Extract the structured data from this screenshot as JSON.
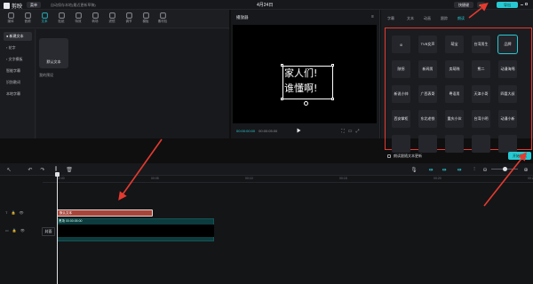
{
  "app": {
    "name": "剪映",
    "menu_label": "菜单",
    "draft_note": "自动保存本地(最近更新草稿)",
    "title": "4月24日"
  },
  "top_right": {
    "shortcut": "快捷键",
    "pro": "",
    "export": "导出"
  },
  "toolbar": {
    "items": [
      {
        "label": "媒体",
        "icon": "media-icon"
      },
      {
        "label": "音频",
        "icon": "audio-icon"
      },
      {
        "label": "文本",
        "icon": "text-icon",
        "active": true
      },
      {
        "label": "贴纸",
        "icon": "sticker-icon"
      },
      {
        "label": "特效",
        "icon": "effects-icon"
      },
      {
        "label": "转场",
        "icon": "transition-icon"
      },
      {
        "label": "滤镜",
        "icon": "filter-icon"
      },
      {
        "label": "调节",
        "icon": "adjust-icon"
      },
      {
        "label": "模板",
        "icon": "template-icon"
      },
      {
        "label": "素材包",
        "icon": "pack-icon"
      }
    ]
  },
  "sidebar": {
    "items": [
      {
        "label": "● 新建文本",
        "active": true
      },
      {
        "label": "› 花字"
      },
      {
        "label": "› 文字模板"
      },
      {
        "label": "智能字幕"
      },
      {
        "label": "识别歌词"
      },
      {
        "label": "本地字幕"
      }
    ]
  },
  "text_content": {
    "default_card": "默认文本",
    "preset_label": "我的预设"
  },
  "player": {
    "title": "播放器",
    "caption_lines": [
      "家人们!",
      "谁懂啊!"
    ],
    "current_time": "00:00:00:00",
    "total_time": "00:00:05:00"
  },
  "right_panel": {
    "tabs": [
      {
        "label": "字幕"
      },
      {
        "label": "文本"
      },
      {
        "label": "动画"
      },
      {
        "label": "跟踪"
      },
      {
        "label": "朗读",
        "active": true
      }
    ],
    "voices": [
      {
        "label": "⊘",
        "kind": "none"
      },
      {
        "label": "TVB女声"
      },
      {
        "label": "萌宝"
      },
      {
        "label": "台湾男生"
      },
      {
        "label": "品牌",
        "selected": true
      },
      {
        "label": "陕拐"
      },
      {
        "label": "新闻男"
      },
      {
        "label": "卖萌贱"
      },
      {
        "label": "熊二"
      },
      {
        "label": "动漫海绵"
      },
      {
        "label": "新说小帅"
      },
      {
        "label": "广西表哥"
      },
      {
        "label": "粤语男"
      },
      {
        "label": "天津小哥"
      },
      {
        "label": "四喜大叔"
      },
      {
        "label": "西安掌柜"
      },
      {
        "label": "东北老铁"
      },
      {
        "label": "重庆小伙"
      },
      {
        "label": "台湾小明"
      },
      {
        "label": "动漫小新"
      },
      {
        "label": ""
      },
      {
        "label": ""
      },
      {
        "label": ""
      },
      {
        "label": ""
      },
      {
        "label": ""
      }
    ],
    "checkbox_label": "朗读跟随文本更新",
    "apply_button": "开始朗读"
  },
  "timeline": {
    "ticks": [
      "00:00",
      "00:05",
      "00:10",
      "00:15",
      "00:20",
      "00:25"
    ],
    "text_clip_label": "默认文本",
    "video_clip_label": "黑场  00:00:05:00",
    "cover_label": "封面"
  },
  "colors": {
    "accent": "#28c9d3",
    "annotation": "#e53a2f",
    "text_clip": "#a6463b",
    "video_clip": "#0c3c3e"
  }
}
